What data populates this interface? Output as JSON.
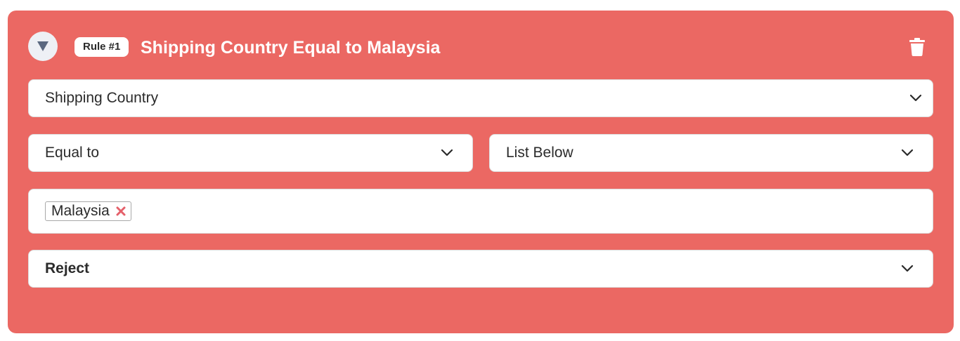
{
  "rule": {
    "badge": "Rule #1",
    "title": "Shipping Country Equal to Malaysia"
  },
  "fields": {
    "field_select": "Shipping Country",
    "operator_select": "Equal to",
    "source_select": "List Below",
    "action_select": "Reject"
  },
  "tags": [
    {
      "label": "Malaysia"
    }
  ],
  "icons": {
    "collapse": "triangle-down-icon",
    "delete": "trash-icon",
    "chevron": "chevron-down-icon",
    "remove_tag": "close-icon"
  },
  "colors": {
    "card_background": "#eb6863",
    "tag_remove": "#e5606a"
  }
}
